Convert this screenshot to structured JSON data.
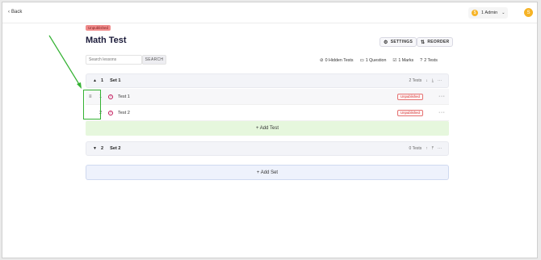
{
  "topbar": {
    "back_label": "Back",
    "admin_label": "1 Admin",
    "admin_coin": "$",
    "avatar_initial": "S"
  },
  "header": {
    "status_badge": "Unpublished",
    "title": "Math Test",
    "settings_label": "SETTINGS",
    "reorder_label": "REORDER"
  },
  "search": {
    "placeholder": "Search lessons",
    "button_label": "SEARCH"
  },
  "stats": {
    "hidden_tests": "0 Hidden Tests",
    "questions": "1 Question",
    "marks": "1 Marks",
    "tests": "2 Tests"
  },
  "sets": [
    {
      "number": "1",
      "name": "Set 1",
      "count_label": "2 Tests",
      "tests": [
        {
          "number": "1",
          "name": "Test 1",
          "status": "Unpublished"
        },
        {
          "number": "2",
          "name": "Test 2",
          "status": "Unpublished"
        }
      ],
      "add_test_label": "+ Add Test"
    },
    {
      "number": "2",
      "name": "Set 2",
      "count_label": "0 Tests"
    }
  ],
  "add_set_label": "+ Add Set",
  "colors": {
    "unpublished_badge": "#f08a8a",
    "add_test_bg": "#e6f7dd",
    "add_set_bg": "#eef2fc",
    "annotation_green": "#34b233",
    "coin": "#f6b325"
  }
}
